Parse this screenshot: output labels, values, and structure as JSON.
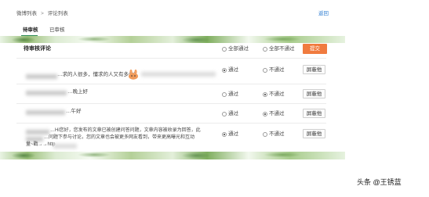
{
  "breadcrumb": {
    "home": "微博列表",
    "separator": ">",
    "current": "评论列表"
  },
  "back_link": "返回",
  "tabs": [
    {
      "label": "待审核",
      "active": true
    },
    {
      "label": "已审核",
      "active": false
    }
  ],
  "header": {
    "title": "待审核评论",
    "all_pass": "全部通过",
    "all_reject": "全部不通过",
    "submit": "提交"
  },
  "rows": [
    {
      "text": "…求的人很多，懂求的人又有多少？",
      "pass": "通过",
      "reject": "不通过",
      "block": "屏蔽他",
      "selected": "pass"
    },
    {
      "text": "…晚上好",
      "pass": "通过",
      "reject": "不通过",
      "block": "屏蔽他",
      "selected": "reject"
    },
    {
      "text": "…午好",
      "pass": "通过",
      "reject": "不通过",
      "block": "屏蔽他",
      "selected": "reject"
    },
    {
      "line1": "…Hi您好，您发布的文章已被创建问答问题，文章内容被收录为回答，此",
      "line2": "…问题下参与讨论，您的文章也会被更多网友看到，带来更高曝光和互动",
      "line3": "量~戳→→http",
      "pass": "通过",
      "reject": "不通过",
      "block": "屏蔽他",
      "selected": "pass"
    }
  ],
  "watermark": "头条 @王锈蓝"
}
